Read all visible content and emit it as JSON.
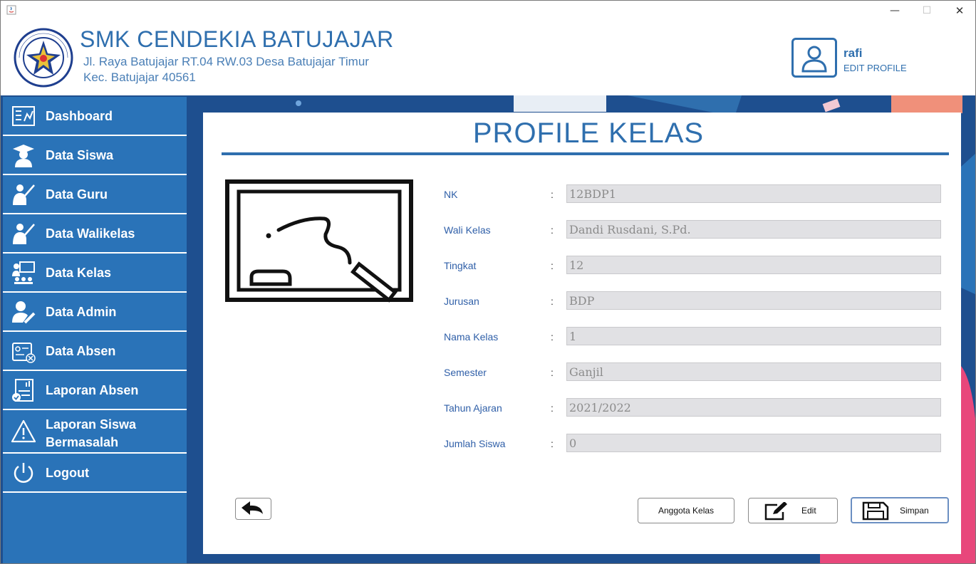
{
  "window": {
    "controls": {
      "minimize": "—",
      "maximize": "☐",
      "close": "✕"
    }
  },
  "header": {
    "school_name": "SMK CENDEKIA BATUJAJAR",
    "address_line1": "Jl. Raya Batujajar RT.04 RW.03 Desa Batujajar Timur",
    "address_line2": "Kec. Batujajar 40561",
    "logo_text_top": "SMK CENDEKIA BATUJAJAR",
    "logo_text_bottom": "YAYASAN PUTRA CENDEKIA"
  },
  "user": {
    "name": "rafi",
    "edit_profile_label": "EDIT PROFILE",
    "icon": "user-profile-icon"
  },
  "sidebar": {
    "items": [
      {
        "label": "Dashboard",
        "icon": "dashboard-icon"
      },
      {
        "label": "Data Siswa",
        "icon": "student-icon"
      },
      {
        "label": "Data Guru",
        "icon": "teacher-icon"
      },
      {
        "label": "Data Walikelas",
        "icon": "homeroom-teacher-icon"
      },
      {
        "label": "Data Kelas",
        "icon": "classroom-icon"
      },
      {
        "label": "Data Admin",
        "icon": "admin-icon"
      },
      {
        "label": "Data Absen",
        "icon": "attendance-icon"
      },
      {
        "label": "Laporan Absen",
        "icon": "report-icon"
      },
      {
        "label": "Laporan Siswa Bermasalah",
        "icon": "warning-icon"
      },
      {
        "label": "Logout",
        "icon": "power-icon"
      }
    ]
  },
  "main": {
    "title": "PROFILE KELAS",
    "illustration_icon": "blackboard-icon",
    "fields": [
      {
        "label": "NK",
        "value": "12BDP1"
      },
      {
        "label": "Wali Kelas",
        "value": "Dandi Rusdani, S.Pd."
      },
      {
        "label": "Tingkat",
        "value": "12"
      },
      {
        "label": "Jurusan",
        "value": "BDP"
      },
      {
        "label": "Nama Kelas",
        "value": "1"
      },
      {
        "label": "Semester",
        "value": "Ganjil"
      },
      {
        "label": "Tahun Ajaran",
        "value": "2021/2022"
      },
      {
        "label": "Jumlah Siswa",
        "value": "0"
      }
    ],
    "colon": ":",
    "buttons": {
      "back_icon": "back-arrow-icon",
      "anggota_label": "Anggota Kelas",
      "edit_label": "Edit",
      "edit_icon": "edit-icon",
      "simpan_label": "Simpan",
      "simpan_icon": "save-icon"
    }
  },
  "colors": {
    "brand_blue": "#2f6fae",
    "sidebar_blue": "#2a73b8",
    "background_blue": "#1e4f8f",
    "field_label": "#2f5fa8",
    "input_bg": "#e1e1e4"
  }
}
